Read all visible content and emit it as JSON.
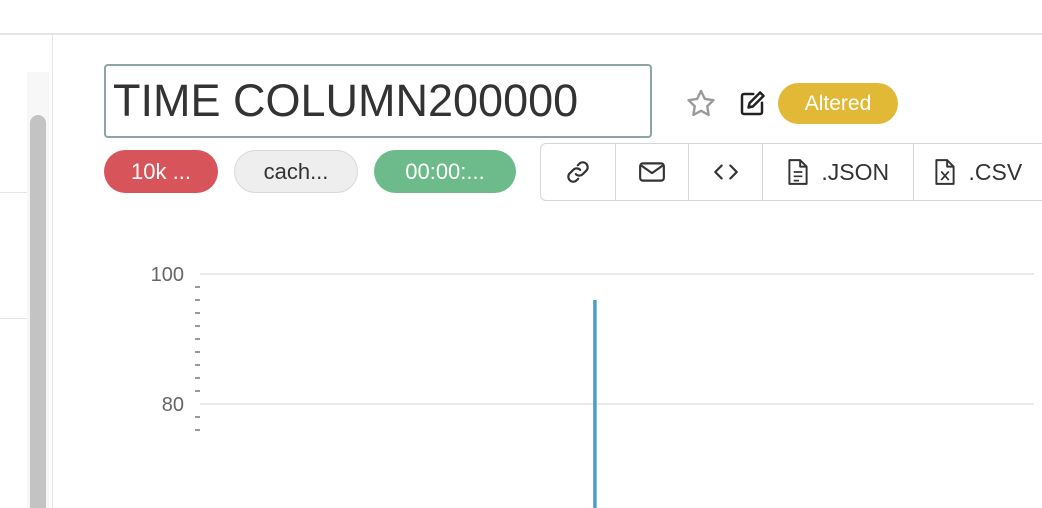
{
  "header": {
    "title_value": "TIME COLUMN200000",
    "status_badge": "Altered"
  },
  "badges": {
    "row_count": "10k ...",
    "cache": "cach...",
    "duration": "00:00:..."
  },
  "actions": {
    "link": "link-icon",
    "email": "envelope-icon",
    "embed": "code-icon",
    "json_label": ".JSON",
    "csv_label": ".CSV"
  },
  "colors": {
    "altered": "#e2b937",
    "row_count": "#d7545b",
    "duration": "#6dbb8a",
    "series": "#4a9fc2"
  },
  "chart_data": {
    "type": "line",
    "title": "",
    "xlabel": "",
    "ylabel": "",
    "y_ticks": [
      "100",
      "80"
    ],
    "ylim_visible": [
      76,
      101
    ],
    "grid": true,
    "series": [
      {
        "x_position_fraction": 0.38,
        "y_top": 96,
        "y_bottom_visible": 76
      }
    ]
  }
}
